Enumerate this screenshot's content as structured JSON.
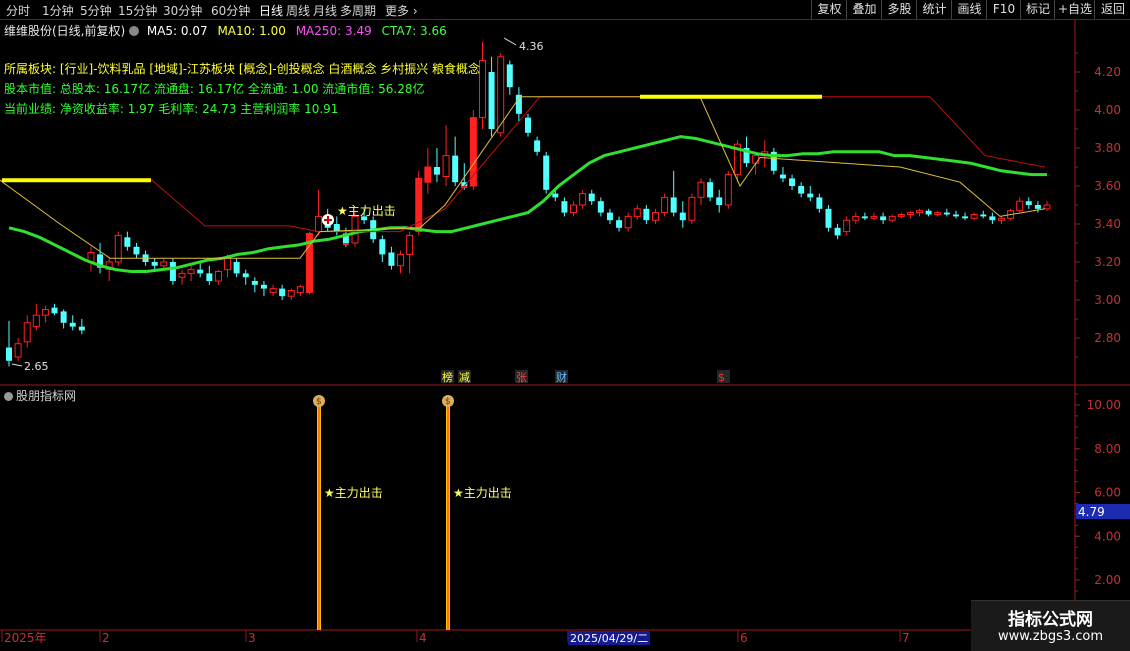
{
  "toolbar": {
    "periods": [
      "分时",
      "1分钟",
      "5分钟",
      "15分钟",
      "30分钟",
      "60分钟",
      "日线",
      "周线",
      "月线",
      "多周期",
      "更多"
    ],
    "active_period": "日线",
    "buttons": [
      "复权",
      "叠加",
      "多股",
      "统计",
      "画线",
      "F10",
      "标记",
      "+自选",
      "返回"
    ]
  },
  "header": {
    "stock_title": "维维股份(日线,前复权)",
    "ma5_label": "MA5: 0.07",
    "ma10_label": "MA10: 1.00",
    "ma250_label": "MA250: 3.49",
    "cta7_label": "CTA7: 3.66"
  },
  "info": {
    "sectors": "所属板块: [行业]-饮料乳品 [地域]-江苏板块 [概念]-创投概念 白酒概念 乡村振兴 粮食概念",
    "capital": "股本市值: 总股本: 16.17亿 流通盘: 16.17亿 全流通: 1.00 流通市值: 56.28亿",
    "performance": "当前业绩: 净资收益率: 1.97 毛利率: 24.73 主营利润率 10.91"
  },
  "annotations": {
    "high_price": "4.36",
    "low_price": "2.65",
    "signal_text": "主力出击",
    "events": [
      "榜",
      "减",
      "张",
      "财",
      "$"
    ]
  },
  "main_axis": {
    "ticks": [
      "4.20",
      "4.00",
      "3.80",
      "3.60",
      "3.40",
      "3.20",
      "3.00",
      "2.80"
    ]
  },
  "sub_panel": {
    "title": "股朋指标网",
    "ticks": [
      "10.00",
      "8.00",
      "6.00",
      "4.00",
      "2.00"
    ],
    "current_value": "4.79",
    "signals": [
      "主力出击",
      "主力出击"
    ],
    "signal_icon": "money-bag-icon"
  },
  "time_axis": {
    "labels": [
      "2025年",
      "2",
      "3",
      "4",
      "2025/04/29/二",
      "6",
      "7"
    ]
  },
  "watermark": {
    "line1": "指标公式网",
    "line2": "www.zbgs3.com"
  },
  "colors": {
    "up": "#ff2020",
    "down": "#54ffff",
    "ma_green": "#30e030",
    "ma_yellow": "#ffff00",
    "ma_red": "#c01010",
    "signal_line": "#ffbf00"
  },
  "chart_data": {
    "type": "candlestick",
    "price_range": [
      2.6,
      4.4
    ],
    "candles": [
      {
        "o": 2.75,
        "h": 2.89,
        "l": 2.65,
        "c": 2.68
      },
      {
        "o": 2.7,
        "h": 2.8,
        "l": 2.68,
        "c": 2.77
      },
      {
        "o": 2.78,
        "h": 2.92,
        "l": 2.75,
        "c": 2.88
      },
      {
        "o": 2.86,
        "h": 2.98,
        "l": 2.84,
        "c": 2.92
      },
      {
        "o": 2.92,
        "h": 2.97,
        "l": 2.88,
        "c": 2.95
      },
      {
        "o": 2.96,
        "h": 2.98,
        "l": 2.92,
        "c": 2.93
      },
      {
        "o": 2.94,
        "h": 2.95,
        "l": 2.85,
        "c": 2.88
      },
      {
        "o": 2.88,
        "h": 2.92,
        "l": 2.84,
        "c": 2.86
      },
      {
        "o": 2.86,
        "h": 2.9,
        "l": 2.82,
        "c": 2.84
      },
      {
        "o": 3.2,
        "h": 3.28,
        "l": 3.15,
        "c": 3.25
      },
      {
        "o": 3.24,
        "h": 3.3,
        "l": 3.14,
        "c": 3.17
      },
      {
        "o": 3.16,
        "h": 3.22,
        "l": 3.1,
        "c": 3.2
      },
      {
        "o": 3.2,
        "h": 3.36,
        "l": 3.18,
        "c": 3.34
      },
      {
        "o": 3.33,
        "h": 3.36,
        "l": 3.26,
        "c": 3.28
      },
      {
        "o": 3.28,
        "h": 3.3,
        "l": 3.22,
        "c": 3.24
      },
      {
        "o": 3.24,
        "h": 3.26,
        "l": 3.18,
        "c": 3.2
      },
      {
        "o": 3.2,
        "h": 3.22,
        "l": 3.16,
        "c": 3.18
      },
      {
        "o": 3.18,
        "h": 3.22,
        "l": 3.16,
        "c": 3.2
      },
      {
        "o": 3.2,
        "h": 3.22,
        "l": 3.08,
        "c": 3.1
      },
      {
        "o": 3.12,
        "h": 3.16,
        "l": 3.08,
        "c": 3.14
      },
      {
        "o": 3.14,
        "h": 3.18,
        "l": 3.1,
        "c": 3.16
      },
      {
        "o": 3.16,
        "h": 3.2,
        "l": 3.12,
        "c": 3.14
      },
      {
        "o": 3.14,
        "h": 3.18,
        "l": 3.08,
        "c": 3.1
      },
      {
        "o": 3.1,
        "h": 3.16,
        "l": 3.08,
        "c": 3.15
      },
      {
        "o": 3.16,
        "h": 3.24,
        "l": 3.12,
        "c": 3.22
      },
      {
        "o": 3.2,
        "h": 3.22,
        "l": 3.12,
        "c": 3.14
      },
      {
        "o": 3.14,
        "h": 3.16,
        "l": 3.08,
        "c": 3.12
      },
      {
        "o": 3.1,
        "h": 3.12,
        "l": 3.04,
        "c": 3.08
      },
      {
        "o": 3.08,
        "h": 3.1,
        "l": 3.02,
        "c": 3.06
      },
      {
        "o": 3.04,
        "h": 3.08,
        "l": 3.02,
        "c": 3.06
      },
      {
        "o": 3.06,
        "h": 3.08,
        "l": 3.0,
        "c": 3.02
      },
      {
        "o": 3.02,
        "h": 3.06,
        "l": 3.0,
        "c": 3.05
      },
      {
        "o": 3.04,
        "h": 3.08,
        "l": 3.02,
        "c": 3.07
      },
      {
        "o": 3.04,
        "h": 3.36,
        "l": 3.03,
        "c": 3.35
      },
      {
        "o": 3.36,
        "h": 3.58,
        "l": 3.34,
        "c": 3.44
      },
      {
        "o": 3.44,
        "h": 3.48,
        "l": 3.36,
        "c": 3.38
      },
      {
        "o": 3.4,
        "h": 3.44,
        "l": 3.34,
        "c": 3.36
      },
      {
        "o": 3.35,
        "h": 3.38,
        "l": 3.28,
        "c": 3.3
      },
      {
        "o": 3.3,
        "h": 3.46,
        "l": 3.28,
        "c": 3.44
      },
      {
        "o": 3.44,
        "h": 3.48,
        "l": 3.4,
        "c": 3.42
      },
      {
        "o": 3.42,
        "h": 3.44,
        "l": 3.3,
        "c": 3.32
      },
      {
        "o": 3.32,
        "h": 3.34,
        "l": 3.2,
        "c": 3.24
      },
      {
        "o": 3.25,
        "h": 3.28,
        "l": 3.16,
        "c": 3.18
      },
      {
        "o": 3.18,
        "h": 3.26,
        "l": 3.14,
        "c": 3.24
      },
      {
        "o": 3.24,
        "h": 3.36,
        "l": 3.14,
        "c": 3.34
      },
      {
        "o": 3.36,
        "h": 3.68,
        "l": 3.34,
        "c": 3.64
      },
      {
        "o": 3.62,
        "h": 3.8,
        "l": 3.56,
        "c": 3.7
      },
      {
        "o": 3.7,
        "h": 3.8,
        "l": 3.62,
        "c": 3.66
      },
      {
        "o": 3.65,
        "h": 3.92,
        "l": 3.6,
        "c": 3.76
      },
      {
        "o": 3.76,
        "h": 3.86,
        "l": 3.6,
        "c": 3.62
      },
      {
        "o": 3.62,
        "h": 3.72,
        "l": 3.58,
        "c": 3.6
      },
      {
        "o": 3.6,
        "h": 4.0,
        "l": 3.58,
        "c": 3.96
      },
      {
        "o": 3.96,
        "h": 4.36,
        "l": 3.9,
        "c": 4.26
      },
      {
        "o": 4.2,
        "h": 4.28,
        "l": 3.86,
        "c": 3.9
      },
      {
        "o": 3.88,
        "h": 4.3,
        "l": 3.86,
        "c": 4.28
      },
      {
        "o": 4.24,
        "h": 4.26,
        "l": 4.08,
        "c": 4.12
      },
      {
        "o": 4.08,
        "h": 4.12,
        "l": 3.94,
        "c": 3.98
      },
      {
        "o": 3.96,
        "h": 3.98,
        "l": 3.86,
        "c": 3.88
      },
      {
        "o": 3.84,
        "h": 3.86,
        "l": 3.76,
        "c": 3.78
      },
      {
        "o": 3.76,
        "h": 3.78,
        "l": 3.56,
        "c": 3.58
      },
      {
        "o": 3.56,
        "h": 3.58,
        "l": 3.52,
        "c": 3.54
      },
      {
        "o": 3.52,
        "h": 3.54,
        "l": 3.44,
        "c": 3.46
      },
      {
        "o": 3.46,
        "h": 3.52,
        "l": 3.44,
        "c": 3.5
      },
      {
        "o": 3.5,
        "h": 3.58,
        "l": 3.48,
        "c": 3.56
      },
      {
        "o": 3.56,
        "h": 3.58,
        "l": 3.5,
        "c": 3.52
      },
      {
        "o": 3.52,
        "h": 3.54,
        "l": 3.44,
        "c": 3.46
      },
      {
        "o": 3.46,
        "h": 3.48,
        "l": 3.4,
        "c": 3.42
      },
      {
        "o": 3.42,
        "h": 3.44,
        "l": 3.36,
        "c": 3.38
      },
      {
        "o": 3.38,
        "h": 3.46,
        "l": 3.36,
        "c": 3.44
      },
      {
        "o": 3.44,
        "h": 3.5,
        "l": 3.42,
        "c": 3.48
      },
      {
        "o": 3.48,
        "h": 3.5,
        "l": 3.4,
        "c": 3.42
      },
      {
        "o": 3.42,
        "h": 3.48,
        "l": 3.4,
        "c": 3.46
      },
      {
        "o": 3.46,
        "h": 3.56,
        "l": 3.44,
        "c": 3.54
      },
      {
        "o": 3.54,
        "h": 3.68,
        "l": 3.44,
        "c": 3.46
      },
      {
        "o": 3.46,
        "h": 3.52,
        "l": 3.38,
        "c": 3.42
      },
      {
        "o": 3.42,
        "h": 3.56,
        "l": 3.4,
        "c": 3.54
      },
      {
        "o": 3.54,
        "h": 3.64,
        "l": 3.5,
        "c": 3.62
      },
      {
        "o": 3.62,
        "h": 3.64,
        "l": 3.52,
        "c": 3.54
      },
      {
        "o": 3.54,
        "h": 3.58,
        "l": 3.46,
        "c": 3.5
      },
      {
        "o": 3.5,
        "h": 3.68,
        "l": 3.48,
        "c": 3.66
      },
      {
        "o": 3.66,
        "h": 3.84,
        "l": 3.62,
        "c": 3.82
      },
      {
        "o": 3.8,
        "h": 3.86,
        "l": 3.7,
        "c": 3.72
      },
      {
        "o": 3.72,
        "h": 3.78,
        "l": 3.66,
        "c": 3.76
      },
      {
        "o": 3.76,
        "h": 3.84,
        "l": 3.7,
        "c": 3.78
      },
      {
        "o": 3.78,
        "h": 3.8,
        "l": 3.66,
        "c": 3.68
      },
      {
        "o": 3.66,
        "h": 3.7,
        "l": 3.62,
        "c": 3.64
      },
      {
        "o": 3.64,
        "h": 3.66,
        "l": 3.58,
        "c": 3.6
      },
      {
        "o": 3.6,
        "h": 3.62,
        "l": 3.54,
        "c": 3.56
      },
      {
        "o": 3.56,
        "h": 3.6,
        "l": 3.52,
        "c": 3.54
      },
      {
        "o": 3.54,
        "h": 3.56,
        "l": 3.46,
        "c": 3.48
      },
      {
        "o": 3.48,
        "h": 3.5,
        "l": 3.36,
        "c": 3.38
      },
      {
        "o": 3.38,
        "h": 3.4,
        "l": 3.32,
        "c": 3.34
      },
      {
        "o": 3.36,
        "h": 3.44,
        "l": 3.34,
        "c": 3.42
      },
      {
        "o": 3.42,
        "h": 3.46,
        "l": 3.4,
        "c": 3.44
      },
      {
        "o": 3.44,
        "h": 3.46,
        "l": 3.42,
        "c": 3.43
      },
      {
        "o": 3.43,
        "h": 3.46,
        "l": 3.42,
        "c": 3.44
      },
      {
        "o": 3.44,
        "h": 3.46,
        "l": 3.4,
        "c": 3.42
      },
      {
        "o": 3.42,
        "h": 3.45,
        "l": 3.41,
        "c": 3.44
      },
      {
        "o": 3.44,
        "h": 3.46,
        "l": 3.43,
        "c": 3.45
      },
      {
        "o": 3.45,
        "h": 3.47,
        "l": 3.43,
        "c": 3.46
      },
      {
        "o": 3.46,
        "h": 3.48,
        "l": 3.44,
        "c": 3.47
      },
      {
        "o": 3.47,
        "h": 3.48,
        "l": 3.44,
        "c": 3.45
      },
      {
        "o": 3.45,
        "h": 3.47,
        "l": 3.44,
        "c": 3.46
      },
      {
        "o": 3.46,
        "h": 3.48,
        "l": 3.44,
        "c": 3.45
      },
      {
        "o": 3.45,
        "h": 3.47,
        "l": 3.43,
        "c": 3.44
      },
      {
        "o": 3.44,
        "h": 3.46,
        "l": 3.42,
        "c": 3.43
      },
      {
        "o": 3.43,
        "h": 3.46,
        "l": 3.42,
        "c": 3.45
      },
      {
        "o": 3.45,
        "h": 3.47,
        "l": 3.43,
        "c": 3.44
      },
      {
        "o": 3.44,
        "h": 3.46,
        "l": 3.4,
        "c": 3.42
      },
      {
        "o": 3.42,
        "h": 3.44,
        "l": 3.4,
        "c": 3.43
      },
      {
        "o": 3.43,
        "h": 3.48,
        "l": 3.42,
        "c": 3.47
      },
      {
        "o": 3.47,
        "h": 3.54,
        "l": 3.46,
        "c": 3.52
      },
      {
        "o": 3.52,
        "h": 3.54,
        "l": 3.48,
        "c": 3.5
      },
      {
        "o": 3.5,
        "h": 3.52,
        "l": 3.46,
        "c": 3.48
      },
      {
        "o": 3.48,
        "h": 3.52,
        "l": 3.47,
        "c": 3.5
      }
    ],
    "ma_green": [
      3.38,
      3.36,
      3.33,
      3.29,
      3.25,
      3.21,
      3.18,
      3.16,
      3.15,
      3.15,
      3.16,
      3.17,
      3.19,
      3.21,
      3.22,
      3.24,
      3.25,
      3.27,
      3.28,
      3.29,
      3.31,
      3.32,
      3.34,
      3.36,
      3.37,
      3.38,
      3.38,
      3.37,
      3.36,
      3.36,
      3.38,
      3.4,
      3.42,
      3.44,
      3.46,
      3.52,
      3.6,
      3.66,
      3.72,
      3.76,
      3.78,
      3.8,
      3.82,
      3.84,
      3.86,
      3.85,
      3.83,
      3.81,
      3.79,
      3.77,
      3.76,
      3.76,
      3.77,
      3.77,
      3.78,
      3.78,
      3.78,
      3.78,
      3.76,
      3.76,
      3.75,
      3.74,
      3.73,
      3.72,
      3.7,
      3.68,
      3.67,
      3.66,
      3.66
    ],
    "indicator_signals": [
      {
        "day": 33,
        "value": 10.0
      },
      {
        "day": 46,
        "value": 10.0
      }
    ]
  }
}
